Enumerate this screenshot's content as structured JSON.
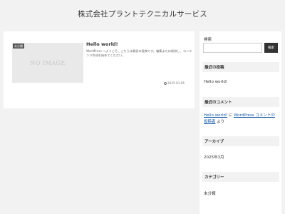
{
  "site": {
    "title": "株式会社プラントテクニカルサービス"
  },
  "post": {
    "category": "未分類",
    "thumbnail_text": "NO IMAGE",
    "title": "Hello world!",
    "excerpt": "WordPress へようこそ。こちらは最初の投稿です。編集または削除し、コンテンツ作成を始めてください。",
    "date": "2025.03.06"
  },
  "sidebar": {
    "search": {
      "label": "検索",
      "placeholder": "",
      "button": "検索"
    },
    "recent_posts": {
      "title": "最近の投稿",
      "items": [
        "Hello world!"
      ]
    },
    "recent_comments": {
      "title": "最近のコメント",
      "post_link": "Hello world!",
      "connector": "に",
      "author_link": "WordPress コメントの投稿者",
      "suffix": "より"
    },
    "archives": {
      "title": "アーカイブ",
      "items": [
        "2025年3月"
      ]
    },
    "categories": {
      "title": "カテゴリー",
      "items": [
        "未分類"
      ]
    }
  },
  "colors": {
    "background": "#f2f2f2",
    "card": "#ffffff",
    "link": "#1a5ca8",
    "button": "#333333"
  }
}
